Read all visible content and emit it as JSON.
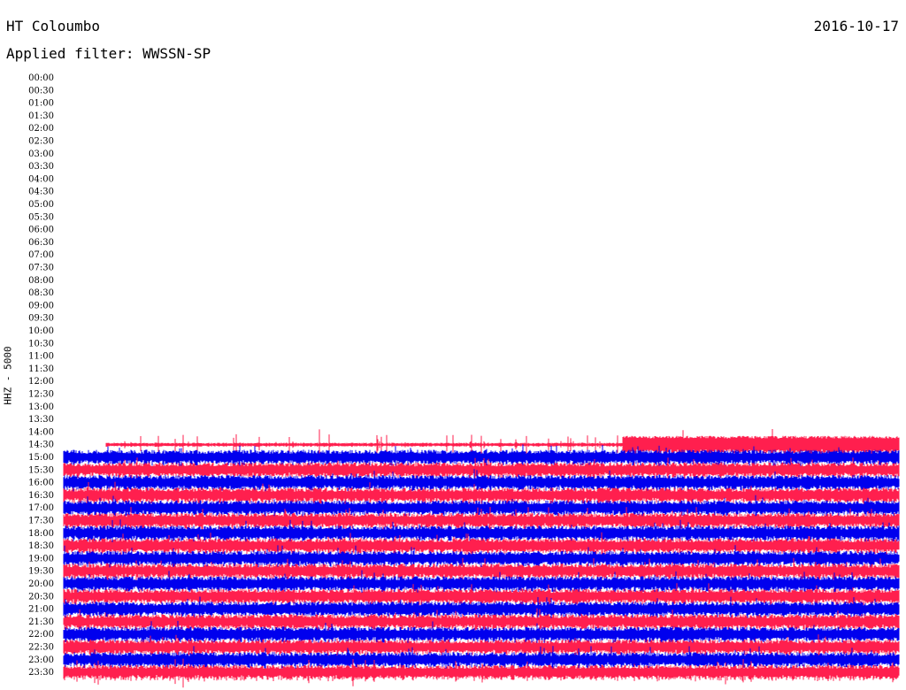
{
  "header": {
    "station": "HT Coloumbo",
    "date": "2016-10-17",
    "filter_label": "Applied filter: WWSSN-SP"
  },
  "chart_data": {
    "type": "line",
    "title": "HT Coloumbo",
    "ylabel": "HHZ - 5000",
    "row_labels": [
      "00:00",
      "00:30",
      "01:00",
      "01:30",
      "02:00",
      "02:30",
      "03:00",
      "03:30",
      "04:00",
      "04:30",
      "05:00",
      "05:30",
      "06:00",
      "06:30",
      "07:00",
      "07:30",
      "08:00",
      "08:30",
      "09:00",
      "09:30",
      "10:00",
      "10:30",
      "11:00",
      "11:30",
      "12:00",
      "12:30",
      "13:00",
      "13:30",
      "14:00",
      "14:30",
      "15:00",
      "15:30",
      "16:00",
      "16:30",
      "17:00",
      "17:30",
      "18:00",
      "18:30",
      "19:00",
      "19:30",
      "20:00",
      "20:30",
      "21:00",
      "21:30",
      "22:00",
      "22:30",
      "23:00",
      "23:30"
    ],
    "series_colors": [
      "#ff1f4e",
      "#0000ee"
    ],
    "active_from_row": "14:30",
    "data_start_fraction": 0,
    "row_amplitude": 1,
    "grid": false,
    "legend": "none"
  }
}
